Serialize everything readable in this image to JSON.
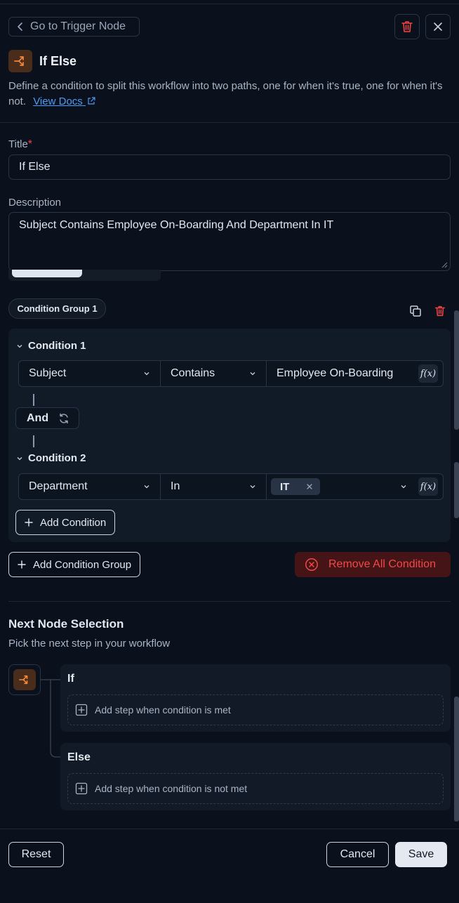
{
  "header": {
    "back_label": "Go to Trigger Node",
    "node_title": "If Else",
    "intro_text": "Define a condition to split this workflow into two paths, one for when it's true, one for when it's not.",
    "docs_link": "View Docs"
  },
  "form": {
    "title_label": "Title",
    "required_mark": "*",
    "title_value": "If Else",
    "description_label": "Description",
    "description_value": "Subject Contains Employee On-Boarding And Department In IT"
  },
  "condition_group": {
    "label": "Condition Group 1",
    "conditions": [
      {
        "title": "Condition 1",
        "field": "Subject",
        "operator": "Contains",
        "value": "Employee On-Boarding"
      },
      {
        "title": "Condition 2",
        "field": "Department",
        "operator": "In",
        "tag": "IT"
      }
    ],
    "connector": "And",
    "add_condition_label": "Add Condition"
  },
  "actions": {
    "add_group_label": "Add Condition Group",
    "remove_all_label": "Remove All Condition"
  },
  "next_node": {
    "title": "Next Node Selection",
    "subtitle": "Pick the next step in your workflow",
    "if_label": "If",
    "if_placeholder": "Add step when condition is met",
    "else_label": "Else",
    "else_placeholder": "Add step when condition is not met"
  },
  "footer": {
    "reset_label": "Reset",
    "cancel_label": "Cancel",
    "save_label": "Save"
  },
  "icons": {
    "fx": "f(x)"
  },
  "colors": {
    "background": "#0a111d",
    "accent_orange": "#f0883e",
    "danger": "#f04848",
    "link": "#4b9cf5"
  }
}
